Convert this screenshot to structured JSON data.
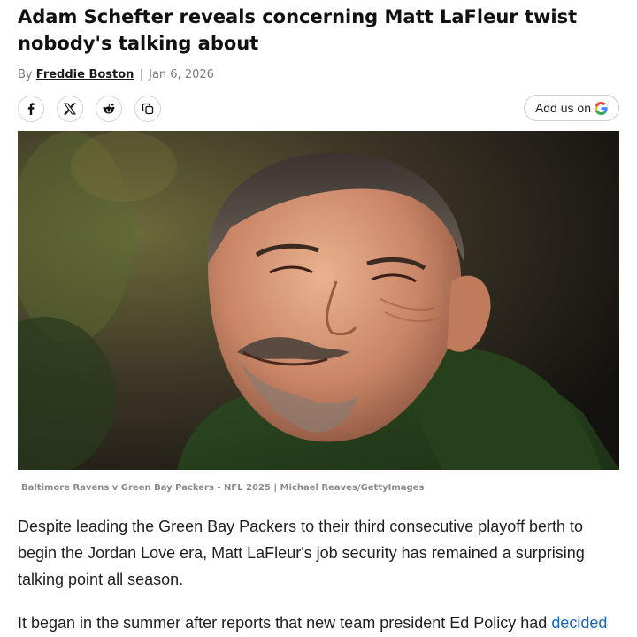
{
  "article": {
    "headline": "Adam Schefter reveals concerning Matt LaFleur twist nobody's talking about",
    "byline_prefix": "By",
    "author": "Freddie Boston",
    "separator": "|",
    "date": "Jan 6, 2026"
  },
  "share": {
    "buttons": [
      {
        "icon": "facebook-icon",
        "glyph": "f"
      },
      {
        "icon": "x-icon",
        "glyph": "𝕏"
      },
      {
        "icon": "reddit-icon",
        "glyph": ""
      },
      {
        "icon": "copy-link-icon",
        "glyph": ""
      }
    ],
    "add_us_label": "Add us on",
    "add_us_icon": "google-icon"
  },
  "image": {
    "description_icon": "hero-photo",
    "caption": "Baltimore Ravens v Green Bay Packers - NFL 2025 | Michael Reaves/GettyImages"
  },
  "body": {
    "paragraph1": "Despite leading the Green Bay Packers to their third consecutive playoff berth to begin the Jordan Love era, Matt LaFleur's job security has remained a surprising talking point all season.",
    "paragraph2_text": "It began in the summer after reports that new team president Ed Policy had ",
    "paragraph2_link": "decided"
  },
  "colors": {
    "link": "#1565c0",
    "google_blue": "#4285F4",
    "google_red": "#EA4335",
    "google_yellow": "#FBBC05",
    "google_green": "#34A853"
  }
}
